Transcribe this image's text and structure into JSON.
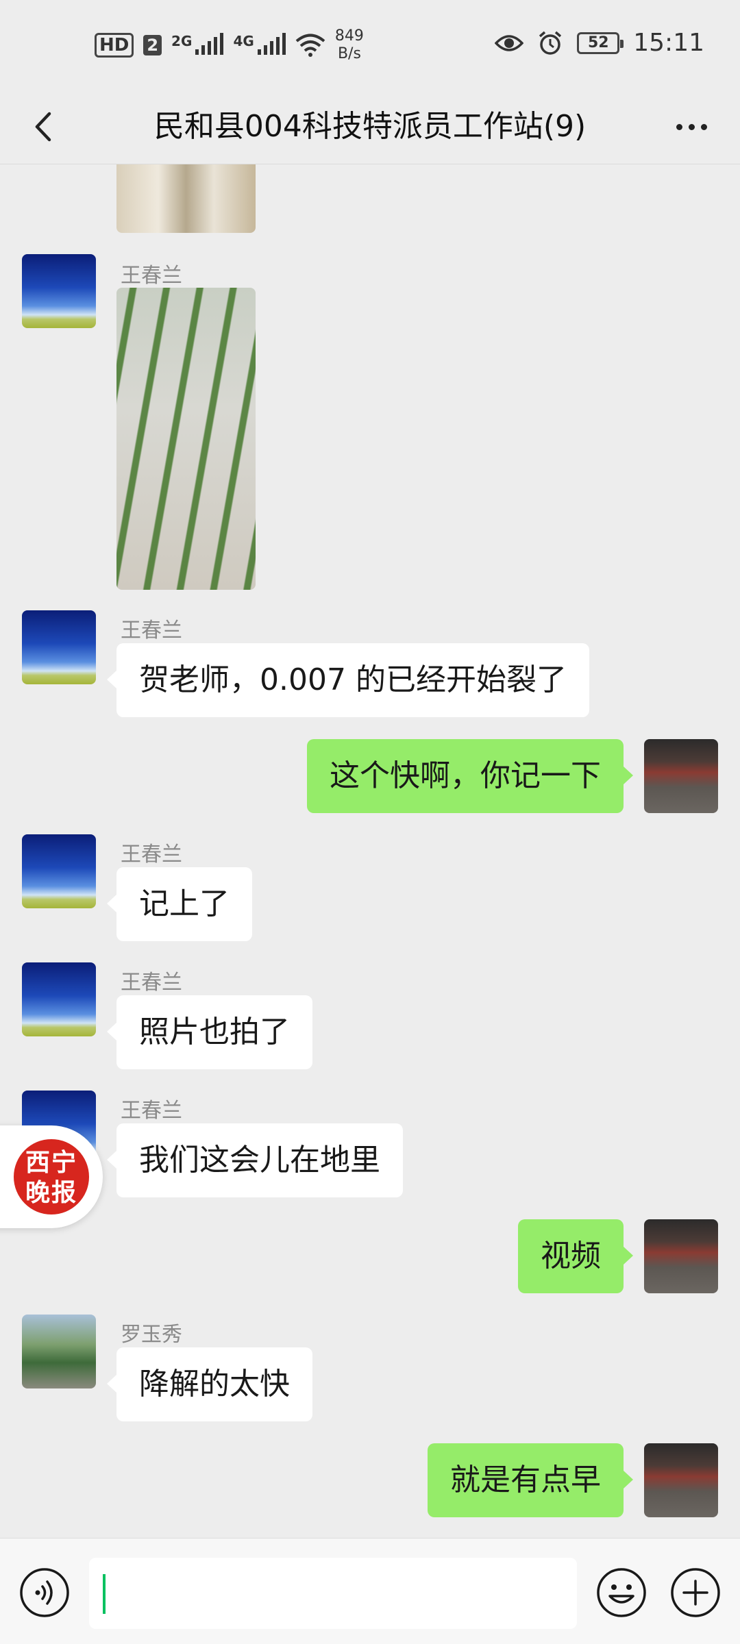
{
  "status_bar": {
    "hd": "HD",
    "sim": "2",
    "net1": "2G",
    "net2": "4G",
    "speed_value": "849",
    "speed_unit": "B/s",
    "battery": "52",
    "time": "15:11"
  },
  "header": {
    "title": "民和县004科技特派员工作站(9)",
    "back_icon": "chevron-left-icon",
    "more_icon": "more-dots-icon"
  },
  "messages": [
    {
      "type": "image",
      "direction": "in",
      "subject": "soil-furrow"
    },
    {
      "type": "image",
      "direction": "in",
      "sender": "王春兰",
      "subject": "seedling-field"
    },
    {
      "type": "text",
      "direction": "in",
      "sender": "王春兰",
      "text": "贺老师，0.007 的已经开始裂了"
    },
    {
      "type": "text",
      "direction": "out",
      "text": "这个快啊，你记一下"
    },
    {
      "type": "text",
      "direction": "in",
      "sender": "王春兰",
      "text": "记上了"
    },
    {
      "type": "text",
      "direction": "in",
      "sender": "王春兰",
      "text": "照片也拍了"
    },
    {
      "type": "text",
      "direction": "in",
      "sender": "王春兰",
      "text": "我们这会儿在地里"
    },
    {
      "type": "text",
      "direction": "out",
      "text": "视频"
    },
    {
      "type": "text",
      "direction": "in",
      "sender": "罗玉秀",
      "text": "降解的太快"
    },
    {
      "type": "text",
      "direction": "out",
      "text": "就是有点早"
    }
  ],
  "floating_logo": {
    "line1": "西宁",
    "line2": "晚报"
  },
  "input_bar": {
    "value": "",
    "voice_icon": "voice-icon",
    "emoji_icon": "emoji-icon",
    "plus_icon": "plus-icon"
  },
  "colors": {
    "background": "#ededed",
    "incoming_bubble": "#ffffff",
    "outgoing_bubble": "#95ec69",
    "caret": "#07c160",
    "logo_red": "#d7261e"
  }
}
